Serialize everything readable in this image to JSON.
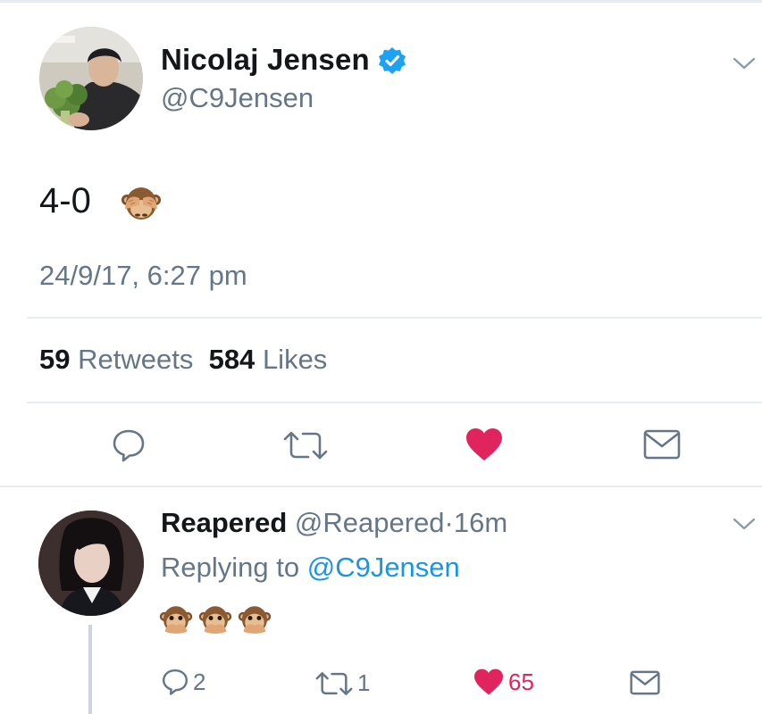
{
  "tweet": {
    "author_name": "Nicolaj Jensen",
    "author_handle": "@C9Jensen",
    "text": "4-0",
    "emoji": "see-no-evil-monkey",
    "timestamp": "24/9/17, 6:27 pm",
    "retweets_count": "59",
    "retweets_label": "Retweets",
    "likes_count": "584",
    "likes_label": "Likes",
    "liked": true,
    "verified": true
  },
  "reply": {
    "author_name": "Reapered",
    "author_handle": "@Reapered",
    "separator": "·",
    "time": "16m",
    "replying_prefix": "Replying to",
    "replying_to": "@C9Jensen",
    "emojis": [
      "speak-no-evil-monkey",
      "speak-no-evil-monkey",
      "speak-no-evil-monkey"
    ],
    "reply_count": "2",
    "retweet_count": "1",
    "like_count": "65",
    "liked": true
  },
  "colors": {
    "text": "#14171a",
    "secondary": "#657786",
    "link": "#1b95e0",
    "like": "#e0245e",
    "verified": "#1da1f2",
    "divider": "#e6ecf0"
  },
  "icons": [
    "verified-badge-icon",
    "chevron-down-icon",
    "reply-icon",
    "retweet-icon",
    "heart-icon",
    "direct-message-icon"
  ]
}
